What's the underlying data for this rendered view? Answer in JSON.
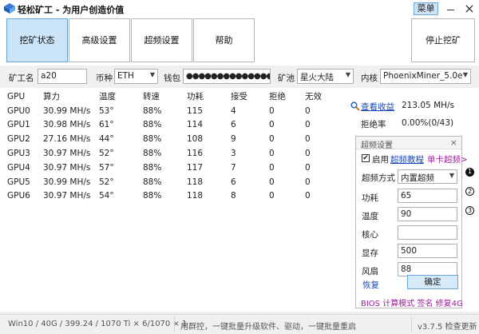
{
  "titlebar": {
    "title": "轻松矿工 - 为用户创造价值",
    "menu_label": "菜单",
    "close_glyph": "×"
  },
  "tabs": [
    {
      "label": "挖矿状态",
      "active": true
    },
    {
      "label": "高级设置",
      "active": false
    },
    {
      "label": "超频设置",
      "active": false
    },
    {
      "label": "帮助",
      "active": false
    }
  ],
  "stop_button": "停止挖矿",
  "config": {
    "miner_name_label": "矿工名",
    "miner_name_value": "a20",
    "coin_label": "币种",
    "coin_value": "ETH",
    "wallet_label": "钱包",
    "wallet_value": "●●●●●●●●●●●●●●●●●●●●●●●●●●●●",
    "pool_label": "矿池",
    "pool_value": "星火大陆",
    "kernel_label": "内核",
    "kernel_value": "PhoenixMiner_5.0e"
  },
  "gpu_table": {
    "headers": [
      "GPU",
      "算力",
      "温度",
      "转速",
      "功耗",
      "接受",
      "拒绝",
      "无效"
    ],
    "rows": [
      [
        "GPU0",
        "30.99 MH/s",
        "53°",
        "88%",
        "115",
        "4",
        "0",
        "0"
      ],
      [
        "GPU1",
        "30.98 MH/s",
        "61°",
        "88%",
        "114",
        "6",
        "0",
        "0"
      ],
      [
        "GPU2",
        "27.16 MH/s",
        "44°",
        "88%",
        "108",
        "9",
        "0",
        "0"
      ],
      [
        "GPU3",
        "30.97 MH/s",
        "52°",
        "88%",
        "116",
        "3",
        "0",
        "0"
      ],
      [
        "GPU4",
        "30.97 MH/s",
        "57°",
        "88%",
        "117",
        "7",
        "0",
        "0"
      ],
      [
        "GPU5",
        "30.99 MH/s",
        "52°",
        "88%",
        "118",
        "6",
        "0",
        "0"
      ],
      [
        "GPU6",
        "30.97 MH/s",
        "54°",
        "88%",
        "118",
        "8",
        "0",
        "0"
      ]
    ]
  },
  "summary": {
    "view_earnings": "查看收益",
    "total_hashrate": "213.05 MH/s",
    "reject_rate_label": "拒绝率",
    "reject_rate_value": "0.00%(0/43)"
  },
  "oc_panel": {
    "title": "超频设置",
    "close_glyph": "×",
    "enable_label": "启用",
    "tutorial_link": "超频教程",
    "single_card_link": "单卡超频>",
    "mode_label": "超频方式",
    "mode_value": "内置超频",
    "power_label": "功耗",
    "power_value": "65",
    "temp_label": "温度",
    "temp_value": "90",
    "core_label": "核心",
    "core_value": "",
    "mem_label": "显存",
    "mem_value": "500",
    "fan_label": "风扇",
    "fan_value": "88",
    "restore_label": "恢复",
    "confirm_label": "确定",
    "footer_links": [
      "BIOS",
      "计算模式",
      "签名",
      "修复4G"
    ]
  },
  "side_icons": [
    "1",
    "2",
    "3"
  ],
  "statusbar": {
    "sysinfo": "Win10 / 40G / 399.24 / 1070 Ti × 6/1070 × 1",
    "hint": "用群控，一键批量升级软件、驱动，一键批量重启",
    "version": "v3.7.5 检查更新"
  },
  "colors": {
    "accent": "#cce4f7",
    "link": "#1a48b6",
    "footer": "#a01da0"
  }
}
